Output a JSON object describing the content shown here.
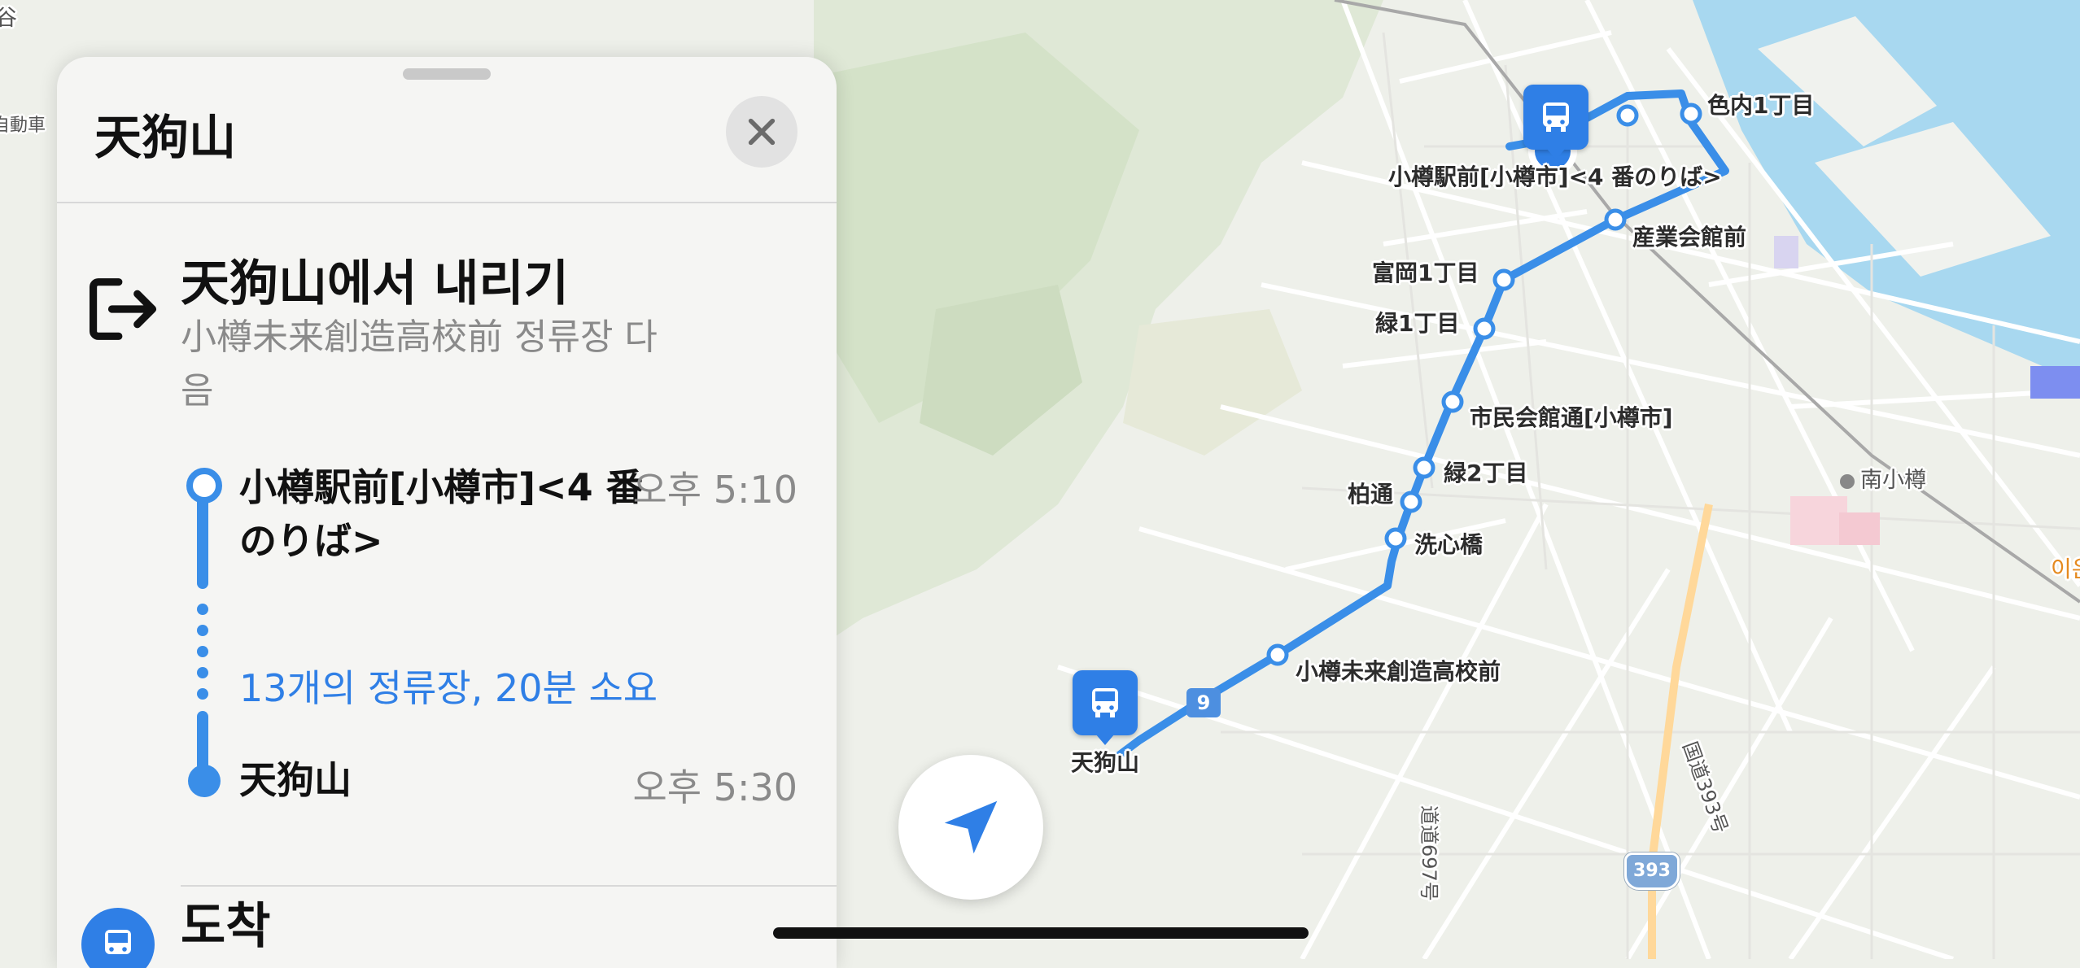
{
  "panel": {
    "title": "天狗山",
    "close_icon": "xmark-icon",
    "step": {
      "icon": "exit-arrow-icon",
      "title": "天狗山에서 내리기",
      "subtitle": "小樽未来創造高校前 정류장 다음"
    },
    "timeline": {
      "start_stop": "小樽駅前[小樽市]<4 番のりば>",
      "start_time": "오후 5:10",
      "stops_summary": "13개의 정류장, 20분 소요",
      "end_stop": "天狗山",
      "end_time": "오후 5:30"
    },
    "arrive": {
      "title": "도착",
      "icon": "bus-icon"
    }
  },
  "map": {
    "route_color": "#3a8ee8",
    "route_number": "9",
    "highway_shield": "393",
    "stop_labels": {
      "shikinai": "色内1丁目",
      "otaru_station": "小樽駅前[小樽市]<4 番のりば>",
      "sangyo": "産業会館前",
      "tomioka": "富岡1丁目",
      "midori1": "緑1丁目",
      "shimin": "市民会館通[小樽市]",
      "midori2": "緑2丁目",
      "kashiwa": "柏通",
      "senshin": "洗心橋",
      "mirai": "小樽未来創造高校前",
      "tengu": "天狗山"
    },
    "place_labels": {
      "minami_otaru": "南小樽",
      "left_top": "谷",
      "left_road": "自動車",
      "right_edge": "이온",
      "road_697": "道道697号",
      "road_393": "国道393号"
    },
    "location_button_icon": "location-arrow-icon"
  }
}
